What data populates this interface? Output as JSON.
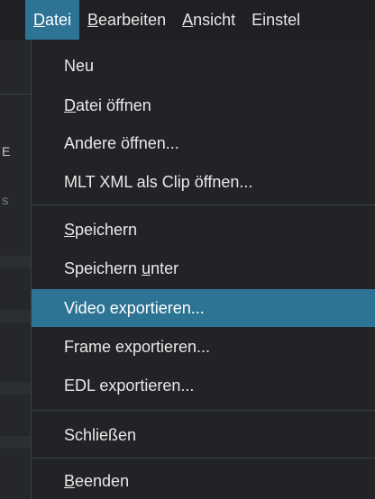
{
  "menubar": {
    "items": [
      {
        "label": "Datei",
        "mnemonic_index": 0,
        "active": true
      },
      {
        "label": "Bearbeiten",
        "mnemonic_index": 0,
        "active": false
      },
      {
        "label": "Ansicht",
        "mnemonic_index": 0,
        "active": false
      },
      {
        "label": "Einstel",
        "mnemonic_index": -1,
        "active": false
      }
    ]
  },
  "background": {
    "glyph_1": "E",
    "glyph_2": "S"
  },
  "file_menu": {
    "items": [
      {
        "label": "Neu"
      },
      {
        "label": "Datei öffnen",
        "mnemonic_pre": "",
        "mnemonic_char": "D",
        "mnemonic_post": "atei öffnen"
      },
      {
        "label": "Andere öffnen..."
      },
      {
        "label": "MLT XML als Clip öffnen..."
      },
      {
        "label": "Speichern",
        "mnemonic_pre": "",
        "mnemonic_char": "S",
        "mnemonic_post": "peichern"
      },
      {
        "label": "Speichern unter",
        "mnemonic_pre": "Speichern ",
        "mnemonic_char": "u",
        "mnemonic_post": "nter"
      },
      {
        "label": "Video exportieren...",
        "highlighted": true
      },
      {
        "label": "Frame exportieren..."
      },
      {
        "label": "EDL exportieren..."
      },
      {
        "label": "Schließen"
      },
      {
        "label": "Beenden",
        "mnemonic_pre": "",
        "mnemonic_char": "B",
        "mnemonic_post": "eenden"
      }
    ]
  },
  "colors": {
    "highlight": "#2d7394",
    "menu_background": "#212326",
    "text": "#e8e8e8"
  }
}
